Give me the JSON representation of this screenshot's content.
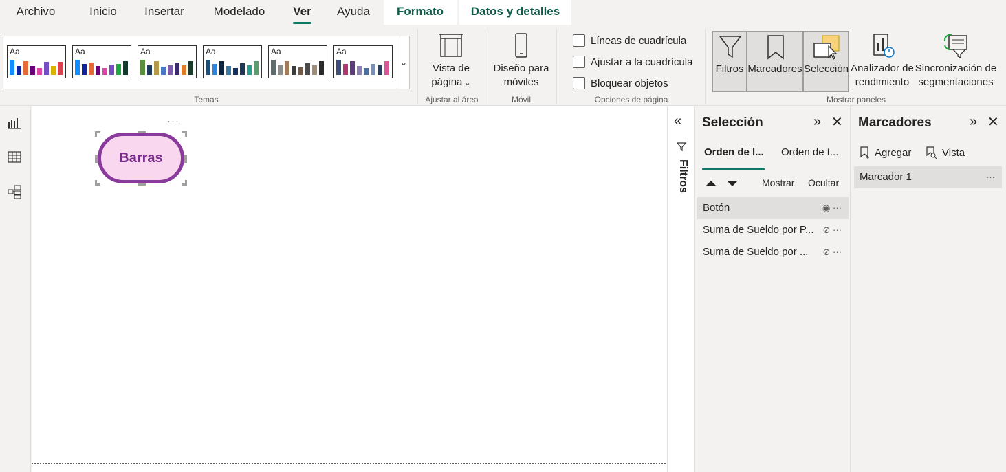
{
  "tabs": [
    {
      "label": "Archivo"
    },
    {
      "label": "Inicio"
    },
    {
      "label": "Insertar"
    },
    {
      "label": "Modelado"
    },
    {
      "label": "Ver"
    },
    {
      "label": "Ayuda"
    },
    {
      "label": "Formato"
    },
    {
      "label": "Datos y detalles"
    }
  ],
  "ribbon": {
    "themes_label": "Temas",
    "theme_aa": "Aa",
    "fit": {
      "label_line1": "Vista de",
      "label_line2": "página",
      "group": "Ajustar al área"
    },
    "mobile": {
      "label_line1": "Diseño para",
      "label_line2": "móviles",
      "group": "Móvil"
    },
    "page_options": {
      "gridlines": "Líneas de cuadrícula",
      "snap": "Ajustar a la cuadrícula",
      "lock": "Bloquear objetos",
      "group": "Opciones de página"
    },
    "panes": {
      "filters": "Filtros",
      "bookmarks": "Marcadores",
      "selection": "Selección",
      "perf_line1": "Analizador de",
      "perf_line2": "rendimiento",
      "sync_line1": "Sincronización de",
      "sync_line2": "segmentaciones",
      "group": "Mostrar paneles"
    }
  },
  "canvas": {
    "button_text": "Barras",
    "more": "···"
  },
  "filters_strip": {
    "label": "Filtros"
  },
  "selection_pane": {
    "title": "Selección",
    "tab_layer": "Orden de l...",
    "tab_tab": "Orden de t...",
    "show": "Mostrar",
    "hide": "Ocultar",
    "items": [
      {
        "label": "Botón",
        "more": "···"
      },
      {
        "label": "Suma de Sueldo por P...",
        "more": "···"
      },
      {
        "label": "Suma de Sueldo por ...",
        "more": "···"
      }
    ]
  },
  "bookmarks_pane": {
    "title": "Marcadores",
    "add": "Agregar",
    "view": "Vista",
    "items": [
      {
        "label": "Marcador 1",
        "more": "···"
      }
    ]
  },
  "colors": {
    "accent": "#117865",
    "button_fill": "#f9d7ef",
    "button_border": "#8a3a9d"
  }
}
